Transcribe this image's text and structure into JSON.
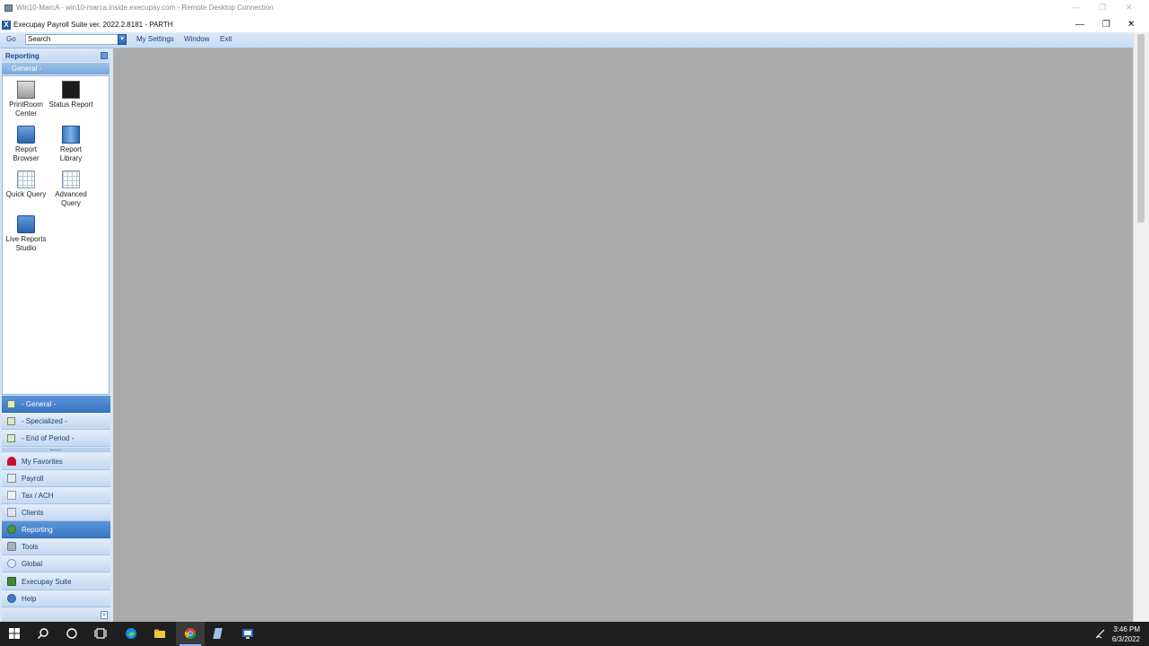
{
  "rdc": {
    "title": "Win10-MarcA - win10-marca.inside.execupay.com - Remote Desktop Connection",
    "minimize_glyph": "—",
    "restore_glyph": "❐",
    "close_glyph": "✕"
  },
  "app": {
    "title": "Execupay Payroll Suite ver. 2022.2.8181 - PARTH",
    "icon_glyph": "X",
    "minimize_glyph": "—",
    "restore_glyph": "❐",
    "close_glyph": "✕",
    "overflow_glyph": "›"
  },
  "menu": {
    "go_label": "Go",
    "search_value": "Search",
    "search_dropdown_glyph": "▾",
    "items": [
      "My Settings",
      "Window",
      "Exit"
    ]
  },
  "sidebar": {
    "header": "Reporting",
    "subheader": "- General -",
    "tiles": [
      {
        "label": "PrintRoom\nCenter",
        "icon": "printroom-icon"
      },
      {
        "label": "Status Report",
        "icon": "status-report-icon"
      },
      {
        "label": "Report\nBrowser",
        "icon": "report-browser-icon"
      },
      {
        "label": "Report\nLibrary",
        "icon": "report-library-icon"
      },
      {
        "label": "Quick Query",
        "icon": "quick-query-icon"
      },
      {
        "label": "Advanced\nQuery",
        "icon": "advanced-query-icon"
      },
      {
        "label": "Live Reports\nStudio",
        "icon": "live-reports-icon"
      }
    ],
    "categories": [
      {
        "label": "- General -",
        "active": true
      },
      {
        "label": "- Specialized -",
        "active": false
      },
      {
        "label": "- End of Period -",
        "active": false
      }
    ],
    "nav": [
      {
        "label": "My Favorites",
        "icon": "heart-icon",
        "color": "#c8102e",
        "active": false
      },
      {
        "label": "Payroll",
        "icon": "payroll-icon",
        "color": "#9aa6b4",
        "active": false
      },
      {
        "label": "Tax / ACH",
        "icon": "tax-ach-icon",
        "color": "#b0b8c4",
        "active": false
      },
      {
        "label": "Clients",
        "icon": "clients-icon",
        "color": "#8fa2bd",
        "active": false
      },
      {
        "label": "Reporting",
        "icon": "reporting-icon",
        "color": "#4c9a3c",
        "active": true
      },
      {
        "label": "Tools",
        "icon": "tools-icon",
        "color": "#7d8794",
        "active": false
      },
      {
        "label": "Global",
        "icon": "global-icon",
        "color": "#6f8fb8",
        "active": false
      },
      {
        "label": "Execupay Suite",
        "icon": "execupay-suite-icon",
        "color": "#3d8a3a",
        "active": false
      },
      {
        "label": "Help",
        "icon": "help-icon",
        "color": "#3f7bc4",
        "active": false
      }
    ]
  },
  "taskbar": {
    "time": "3:46 PM",
    "date": "6/3/2022"
  }
}
